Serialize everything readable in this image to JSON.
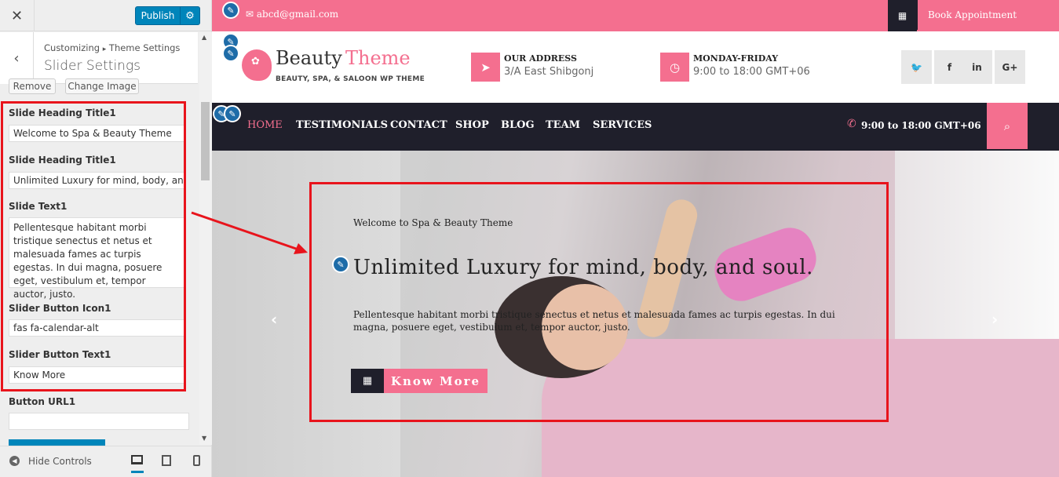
{
  "customizer": {
    "close_icon": "close-icon",
    "publish_label": "Publish",
    "gear_icon": "gear-icon",
    "breadcrumb_root": "Customizing",
    "breadcrumb_arrow": "▸",
    "breadcrumb_section": "Theme Settings",
    "section_title": "Slider Settings",
    "remove_label": "Remove",
    "change_image_label": "Change Image",
    "fields": [
      {
        "label": "Slide Heading Title1",
        "value": "Welcome to Spa & Beauty Theme"
      },
      {
        "label": "Slide Heading Title1",
        "value": "Unlimited Luxury for mind, body, and soul."
      },
      {
        "label": "Slide Text1",
        "value": "Pellentesque habitant morbi tristique senectus et netus et malesuada fames ac turpis egestas. In dui magna, posuere eget, vestibulum et, tempor auctor, justo."
      },
      {
        "label": "Slider Button Icon1",
        "value": "fas fa-calendar-alt"
      },
      {
        "label": "Slider Button Text1",
        "value": "Know More"
      },
      {
        "label": "Button URL1",
        "value": ""
      }
    ],
    "hide_controls_label": "Hide Controls"
  },
  "site": {
    "email": "abcd@gmail.com",
    "book_label": "Book Appointment",
    "brand_name_1": "Beauty",
    "brand_name_2": "Theme",
    "tagline": "BEAUTY, SPA, & SALOON WP THEME",
    "address_label": "OUR ADDRESS",
    "address_value": "3/A East Shibgonj",
    "hours_label": "MONDAY-FRIDAY",
    "hours_value": "9:00 to 18:00 GMT+06",
    "social": [
      "twitter-icon",
      "facebook-icon",
      "linkedin-icon",
      "google-plus-icon"
    ],
    "social_glyphs": [
      "🐦",
      "f",
      "in",
      "G+"
    ],
    "nav": [
      "HOME",
      "TESTIMONIALS",
      "CONTACT",
      "SHOP",
      "BLOG",
      "TEAM",
      "SERVICES"
    ],
    "nav_time": "9:00 to 18:00 GMT+06",
    "slide": {
      "small": "Welcome to Spa & Beauty Theme",
      "big": "Unlimited Luxury for mind, body, and soul.",
      "text": "Pellentesque habitant morbi tristique senectus et netus et malesuada fames ac turpis egestas. In dui magna, posuere eget, vestibulum et, tempor auctor, justo.",
      "button": "Know More"
    }
  },
  "colors": {
    "accent": "#f46f8f",
    "dark": "#1f1f2b",
    "wp_blue": "#0085ba",
    "highlight": "#e8141c"
  }
}
